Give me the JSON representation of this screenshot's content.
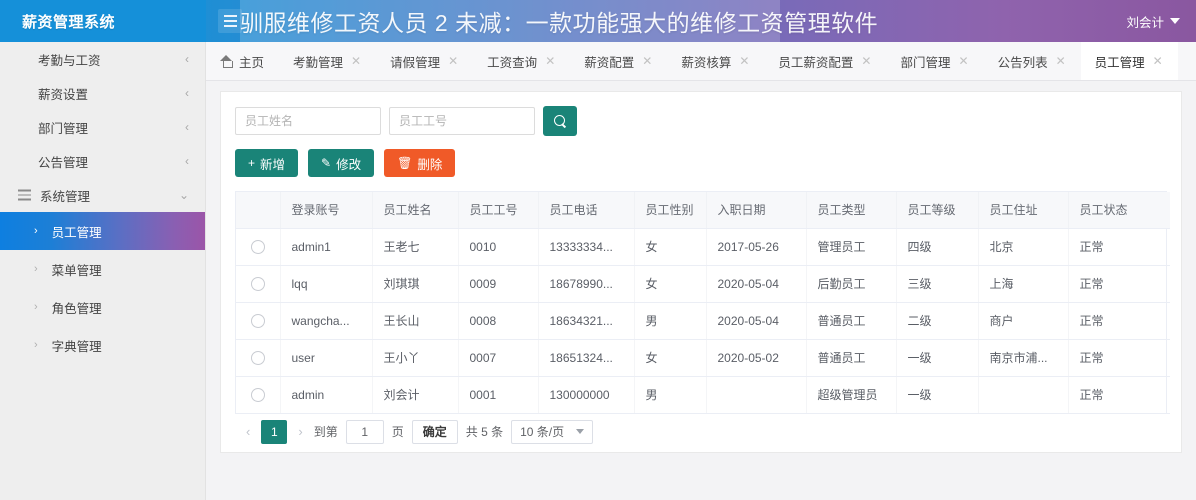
{
  "header": {
    "logo": "薪资管理系统",
    "overlay_title": "驯服维修工资人员 2 未减：一款功能强大的维修工资管理软件",
    "user": "刘会计",
    "menu_icon": "hamburger-icon",
    "caret_icon": "caret-down-icon"
  },
  "sidebar": {
    "items": [
      {
        "label": "考勤与工资",
        "chev": "‹",
        "has_icon": false
      },
      {
        "label": "薪资设置",
        "chev": "‹",
        "has_icon": false
      },
      {
        "label": "部门管理",
        "chev": "‹",
        "has_icon": false
      },
      {
        "label": "公告管理",
        "chev": "‹",
        "has_icon": false
      },
      {
        "label": "系统管理",
        "chev": "⌄",
        "has_icon": true
      }
    ],
    "sub_items": [
      {
        "label": "员工管理",
        "chev": "›",
        "active": true
      },
      {
        "label": "菜单管理",
        "chev": "›",
        "active": false
      },
      {
        "label": "角色管理",
        "chev": "›",
        "active": false
      },
      {
        "label": "字典管理",
        "chev": "›",
        "active": false
      }
    ]
  },
  "tabs": [
    {
      "label": "主页",
      "closable": false,
      "active": false,
      "home": true
    },
    {
      "label": "考勤管理",
      "closable": true,
      "active": false
    },
    {
      "label": "请假管理",
      "closable": true,
      "active": false
    },
    {
      "label": "工资查询",
      "closable": true,
      "active": false
    },
    {
      "label": "薪资配置",
      "closable": true,
      "active": false
    },
    {
      "label": "薪资核算",
      "closable": true,
      "active": false
    },
    {
      "label": "员工薪资配置",
      "closable": true,
      "active": false
    },
    {
      "label": "部门管理",
      "closable": true,
      "active": false
    },
    {
      "label": "公告列表",
      "closable": true,
      "active": false
    },
    {
      "label": "员工管理",
      "closable": true,
      "active": true
    }
  ],
  "search": {
    "name_placeholder": "员工姓名",
    "name_value": "",
    "no_placeholder": "员工工号",
    "no_value": "",
    "search_icon": "search-icon"
  },
  "actions": [
    {
      "label": "新增",
      "glyph": "+",
      "style": "teal"
    },
    {
      "label": "修改",
      "glyph": "✎",
      "style": "teal"
    },
    {
      "label": "删除",
      "glyph": "🗑",
      "style": "red"
    }
  ],
  "table": {
    "columns": [
      "登录账号",
      "员工姓名",
      "员工工号",
      "员工电话",
      "员工性别",
      "入职日期",
      "员工类型",
      "员工等级",
      "员工住址",
      "员工状态"
    ],
    "rows": [
      {
        "account": "admin1",
        "name": "王老七",
        "no": "0010",
        "tel": "13333334...",
        "sex": "女",
        "date": "2017-05-26",
        "type": "管理员工",
        "level": "四级",
        "addr": "北京",
        "status": "正常"
      },
      {
        "account": "lqq",
        "name": "刘琪琪",
        "no": "0009",
        "tel": "18678990...",
        "sex": "女",
        "date": "2020-05-04",
        "type": "后勤员工",
        "level": "三级",
        "addr": "上海",
        "status": "正常"
      },
      {
        "account": "wangcha...",
        "name": "王长山",
        "no": "0008",
        "tel": "18634321...",
        "sex": "男",
        "date": "2020-05-04",
        "type": "普通员工",
        "level": "二级",
        "addr": "商户",
        "status": "正常"
      },
      {
        "account": "user",
        "name": "王小丫",
        "no": "0007",
        "tel": "18651324...",
        "sex": "女",
        "date": "2020-05-02",
        "type": "普通员工",
        "level": "一级",
        "addr": "南京市浦...",
        "status": "正常"
      },
      {
        "account": "admin",
        "name": "刘会计",
        "no": "0001",
        "tel": "130000000",
        "sex": "男",
        "date": "",
        "type": "超级管理员",
        "level": "一级",
        "addr": "",
        "status": "正常"
      }
    ]
  },
  "pagination": {
    "prev": "‹",
    "next": "›",
    "current_page": "1",
    "goto_label": "到第",
    "goto_value": "1",
    "page_unit": "页",
    "confirm": "确定",
    "total": "共 5 条",
    "page_size": "10 条/页"
  },
  "colors": {
    "teal": "#1a8478",
    "red": "#f05a28",
    "header_blue": "#1590d9",
    "header_purple": "#8a57a0"
  }
}
